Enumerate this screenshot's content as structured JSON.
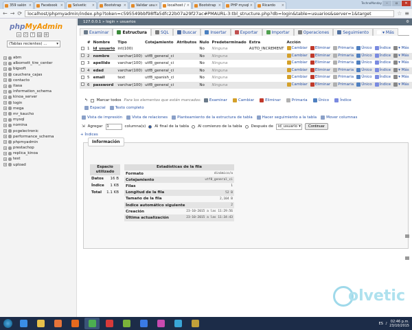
{
  "browser": {
    "tabs": [
      {
        "label": "359 salón",
        "active": false
      },
      {
        "label": "Facebook",
        "active": false
      },
      {
        "label": "Solvetic",
        "active": false
      },
      {
        "label": "Bootstrap",
        "active": false
      },
      {
        "label": "Validar usu",
        "active": false
      },
      {
        "label": "localhost /",
        "active": true
      },
      {
        "label": "Bootstrap",
        "active": false
      },
      {
        "label": "PHP mysql",
        "active": false
      },
      {
        "label": "Ricardo",
        "active": false
      }
    ],
    "user_badge": "TechnoMonday",
    "url": "localhost/phpmyadmin/index.php?token=c595549bbf98ffa5dfc22b07a29f27ac#PMAURL-3:tbl_structure.php?db=login&table=usuarios&server=1&target"
  },
  "sidebar": {
    "logo_php": "php",
    "logo_my": "MyAdmin",
    "recent_placeholder": "(Tablas recientes) ...",
    "databases": [
      "abm",
      "albornett_tire_center",
      "bigsoft",
      "cauchera_cajas",
      "contacto",
      "itasa",
      "information_schema",
      "kinoa_server",
      "login",
      "mega",
      "mr_kaucho",
      "mysql",
      "nomina",
      "pcgelectronic",
      "performance_schema",
      "phpmyadmin",
      "prestachop",
      "replica_kinoa",
      "test",
      "upload"
    ]
  },
  "main": {
    "breadcrumb": "127.0.0.1 »  login »  usuarios",
    "tabs": [
      {
        "label": "Examinar",
        "active": false,
        "color": "#6a7a8a"
      },
      {
        "label": "Estructura",
        "active": true,
        "color": "#3a8a3a"
      },
      {
        "label": "SQL",
        "active": false,
        "color": "#7a7a7a"
      },
      {
        "label": "Buscar",
        "active": false,
        "color": "#4a6aa0"
      },
      {
        "label": "Insertar",
        "active": false,
        "color": "#4a80c0"
      },
      {
        "label": "Exportar",
        "active": false,
        "color": "#c05050"
      },
      {
        "label": "Importar",
        "active": false,
        "color": "#50a050"
      },
      {
        "label": "Operaciones",
        "active": false,
        "color": "#808080"
      },
      {
        "label": "Seguimiento",
        "active": false,
        "color": "#5070a0"
      },
      {
        "label": "▾ Más",
        "active": false,
        "color": "#ffffff"
      }
    ],
    "table_headers": [
      "#",
      "Nombre",
      "Tipo",
      "Cotejamiento",
      "Atributos",
      "Nulo",
      "Predeterminado",
      "Extra",
      "Acción"
    ],
    "columns": [
      {
        "n": "1",
        "name": "id_usuario",
        "type": "int(100)",
        "collation": "",
        "attributes": "",
        "null": "No",
        "default": "Ninguna",
        "extra": "AUTO_INCREMENT"
      },
      {
        "n": "2",
        "name": "nombre",
        "type": "varchar(100)",
        "collation": "utf8_general_ci",
        "attributes": "",
        "null": "No",
        "default": "Ninguna",
        "extra": ""
      },
      {
        "n": "3",
        "name": "apellido",
        "type": "varchar(100)",
        "collation": "utf8_general_ci",
        "attributes": "",
        "null": "No",
        "default": "Ninguna",
        "extra": ""
      },
      {
        "n": "4",
        "name": "edad",
        "type": "varchar(100)",
        "collation": "utf8_general_ci",
        "attributes": "",
        "null": "No",
        "default": "Ninguna",
        "extra": ""
      },
      {
        "n": "5",
        "name": "email",
        "type": "text",
        "collation": "utf8_spanish_ci",
        "attributes": "",
        "null": "No",
        "default": "Ninguna",
        "extra": ""
      },
      {
        "n": "6",
        "name": "password",
        "type": "varchar(100)",
        "collation": "utf8_general_ci",
        "attributes": "",
        "null": "No",
        "default": "Ninguna",
        "extra": ""
      }
    ],
    "row_actions": [
      "Cambiar",
      "Eliminar",
      "Primaria",
      "Único",
      "Índice",
      "▾ Más"
    ],
    "marked": {
      "check_all": "Marcar todos",
      "for_marked": "Para los elementos que están marcados:",
      "actions": [
        "Examinar",
        "Cambiar",
        "Eliminar",
        "Primaria",
        "Único",
        "Índice"
      ],
      "actions2": [
        "Espacial",
        "Texto completo"
      ]
    },
    "links": [
      "Vista de impresión",
      "Vista de relaciones",
      "Planteamiento de la estructura de tabla",
      "Hacer seguimiento a la tabla",
      "Mover columnas"
    ],
    "add": {
      "label": "Agregar",
      "count": "1",
      "columns_label": "columna(s)",
      "at_end": "Al final de la tabla",
      "at_start": "Al comienzo de la tabla",
      "after": "Después de",
      "after_column": "id_usuario",
      "go": "Continuar"
    },
    "indices": "+ Índices",
    "info": {
      "legend": "Información",
      "space_header": "Espacio utilizado",
      "space": [
        {
          "label": "Datos",
          "value": "16 B"
        },
        {
          "label": "Índice",
          "value": "1 KB"
        },
        {
          "label": "Total",
          "value": "1.1 KB"
        }
      ],
      "stats_header": "Estadísticas de la fila",
      "stats": [
        {
          "label": "Formato",
          "value": "dinámico/a"
        },
        {
          "label": "Cotejamiento",
          "value": "utf8_general_ci"
        },
        {
          "label": "Filas",
          "value": "1"
        },
        {
          "label": "Longitud de la fila",
          "value": "52 B"
        },
        {
          "label": "Tamaño de la fila",
          "value": "2,104 B"
        },
        {
          "label": "Índice automático siguiente",
          "value": "2"
        },
        {
          "label": "Creación",
          "value": "23-10-2015 a las 11:29:56"
        },
        {
          "label": "Última actualización",
          "value": "23-10-2015 a las 11:34:43"
        }
      ]
    }
  },
  "watermark": "olvetic",
  "taskbar": {
    "apps": [
      {
        "name": "ie",
        "color": "#3a8ee6"
      },
      {
        "name": "explorer",
        "color": "#e6c04a"
      },
      {
        "name": "media",
        "color": "#e6743a"
      },
      {
        "name": "firefox",
        "color": "#e66a1e"
      },
      {
        "name": "chrome",
        "color": "#4caf50"
      },
      {
        "name": "app6",
        "color": "#d83a3a"
      },
      {
        "name": "app7",
        "color": "#7ab33a"
      },
      {
        "name": "app8",
        "color": "#3a7ae6"
      },
      {
        "name": "app9",
        "color": "#c84ab0"
      },
      {
        "name": "app10",
        "color": "#3aa6d8"
      },
      {
        "name": "app11",
        "color": "#c0a03a"
      }
    ],
    "lang": "ES",
    "time": "02:46 p.m.",
    "date": "23/10/2015"
  }
}
